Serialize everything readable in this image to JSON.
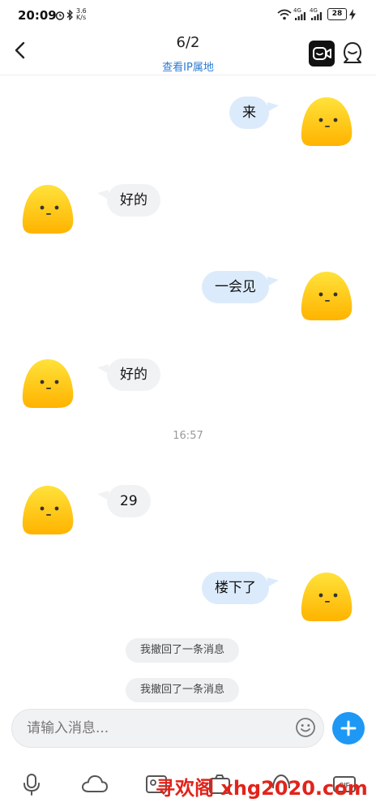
{
  "status_bar": {
    "time": "20:09",
    "speed_top": "3.6",
    "speed_unit": "K/s",
    "signal_label": "4G",
    "battery": "28"
  },
  "header": {
    "title": "6/2",
    "subtitle": "查看IP属地",
    "back_icon": "chevron-left-icon",
    "video_icon": "video-call-icon",
    "profile_icon": "profile-icon"
  },
  "messages": [
    {
      "side": "out",
      "text": "来"
    },
    {
      "side": "in",
      "text": "好的"
    },
    {
      "side": "out",
      "text": "一会见"
    },
    {
      "side": "in",
      "text": "好的"
    },
    {
      "side": "in",
      "text": "29"
    },
    {
      "side": "out",
      "text": "楼下了"
    }
  ],
  "timestamp": "16:57",
  "recall_notices": [
    "我撤回了一条消息",
    "我撤回了一条消息"
  ],
  "input": {
    "placeholder": "请输入消息..."
  },
  "toolbar": {
    "icons": [
      "microphone-icon",
      "cloud-icon",
      "contact-card-icon",
      "camera-icon",
      "red-packet-icon",
      "gif-icon"
    ]
  },
  "watermark": "寻欢阁 xhg2020.com",
  "colors": {
    "accent": "#1d98f5",
    "link": "#2a7bd6",
    "bubble_out": "#dcebfb",
    "bubble_in": "#f1f2f4",
    "avatar": "#ffcc1a"
  }
}
